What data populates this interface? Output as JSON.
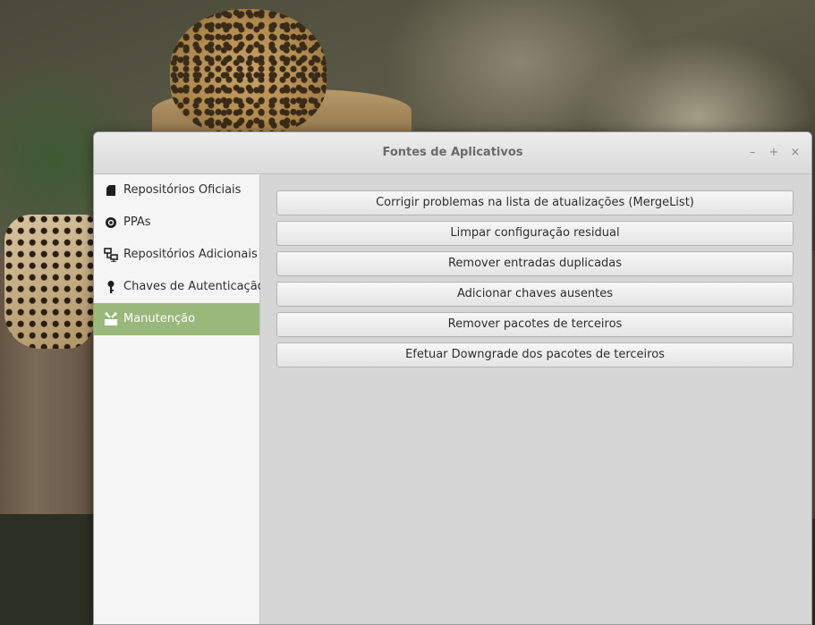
{
  "window": {
    "title": "Fontes de Aplicativos",
    "controls": {
      "minimize": "–",
      "maximize": "+",
      "close": "×"
    }
  },
  "sidebar": {
    "items": [
      {
        "label": "Repositórios Oficiais",
        "icon": "package-icon"
      },
      {
        "label": "PPAs",
        "icon": "ppa-icon"
      },
      {
        "label": "Repositórios Adicionais",
        "icon": "network-icon"
      },
      {
        "label": "Chaves de Autenticação",
        "icon": "key-icon"
      },
      {
        "label": "Manutenção",
        "icon": "maintenance-icon",
        "active": true
      }
    ],
    "active_color": "#9ab87a"
  },
  "actions": [
    "Corrigir problemas na lista de atualizações (MergeList)",
    "Limpar configuração residual",
    "Remover entradas duplicadas",
    "Adicionar chaves ausentes",
    "Remover pacotes de terceiros",
    "Efetuar Downgrade dos pacotes de terceiros"
  ]
}
